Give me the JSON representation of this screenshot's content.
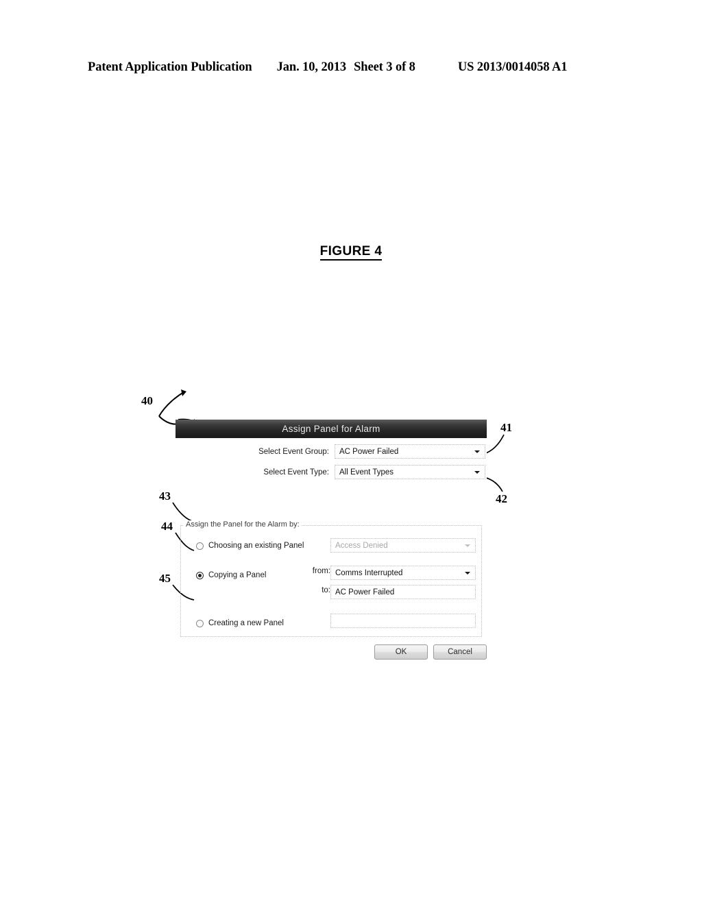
{
  "page_header": {
    "publication": "Patent Application Publication",
    "date": "Jan. 10, 2013",
    "sheet": "Sheet 3 of 8",
    "patent_number": "US 2013/0014058 A1"
  },
  "figure": {
    "caption": "FIGURE 4"
  },
  "dialog": {
    "title": "Assign Panel for Alarm",
    "fields": [
      {
        "label": "Select Event Group:",
        "value": "AC Power Failed",
        "type": "dropdown",
        "disabled": false
      },
      {
        "label": "Select Event Type:",
        "value": "All Event Types",
        "type": "dropdown",
        "disabled": false
      }
    ],
    "group": {
      "label": "Assign the Panel for the Alarm by:",
      "options": [
        {
          "label": "Choosing an existing Panel",
          "selected": false,
          "value": "Access Denied",
          "value_disabled": true
        },
        {
          "label": "Copying a Panel",
          "selected": true
        },
        {
          "label": "Creating a new Panel",
          "selected": false,
          "value": "",
          "value_disabled": false
        }
      ],
      "copy_from_label": "from:",
      "copy_from_value": "Comms Interrupted",
      "copy_to_label": "to:",
      "copy_to_value": "AC Power Failed"
    },
    "buttons": {
      "ok": "OK",
      "cancel": "Cancel"
    }
  },
  "reference_numerals": {
    "dialog": "40",
    "event_group_dropdown": "41",
    "event_type_dropdown": "42",
    "choose_existing_radio": "43",
    "copy_panel_radio": "44",
    "create_new_radio": "45"
  }
}
